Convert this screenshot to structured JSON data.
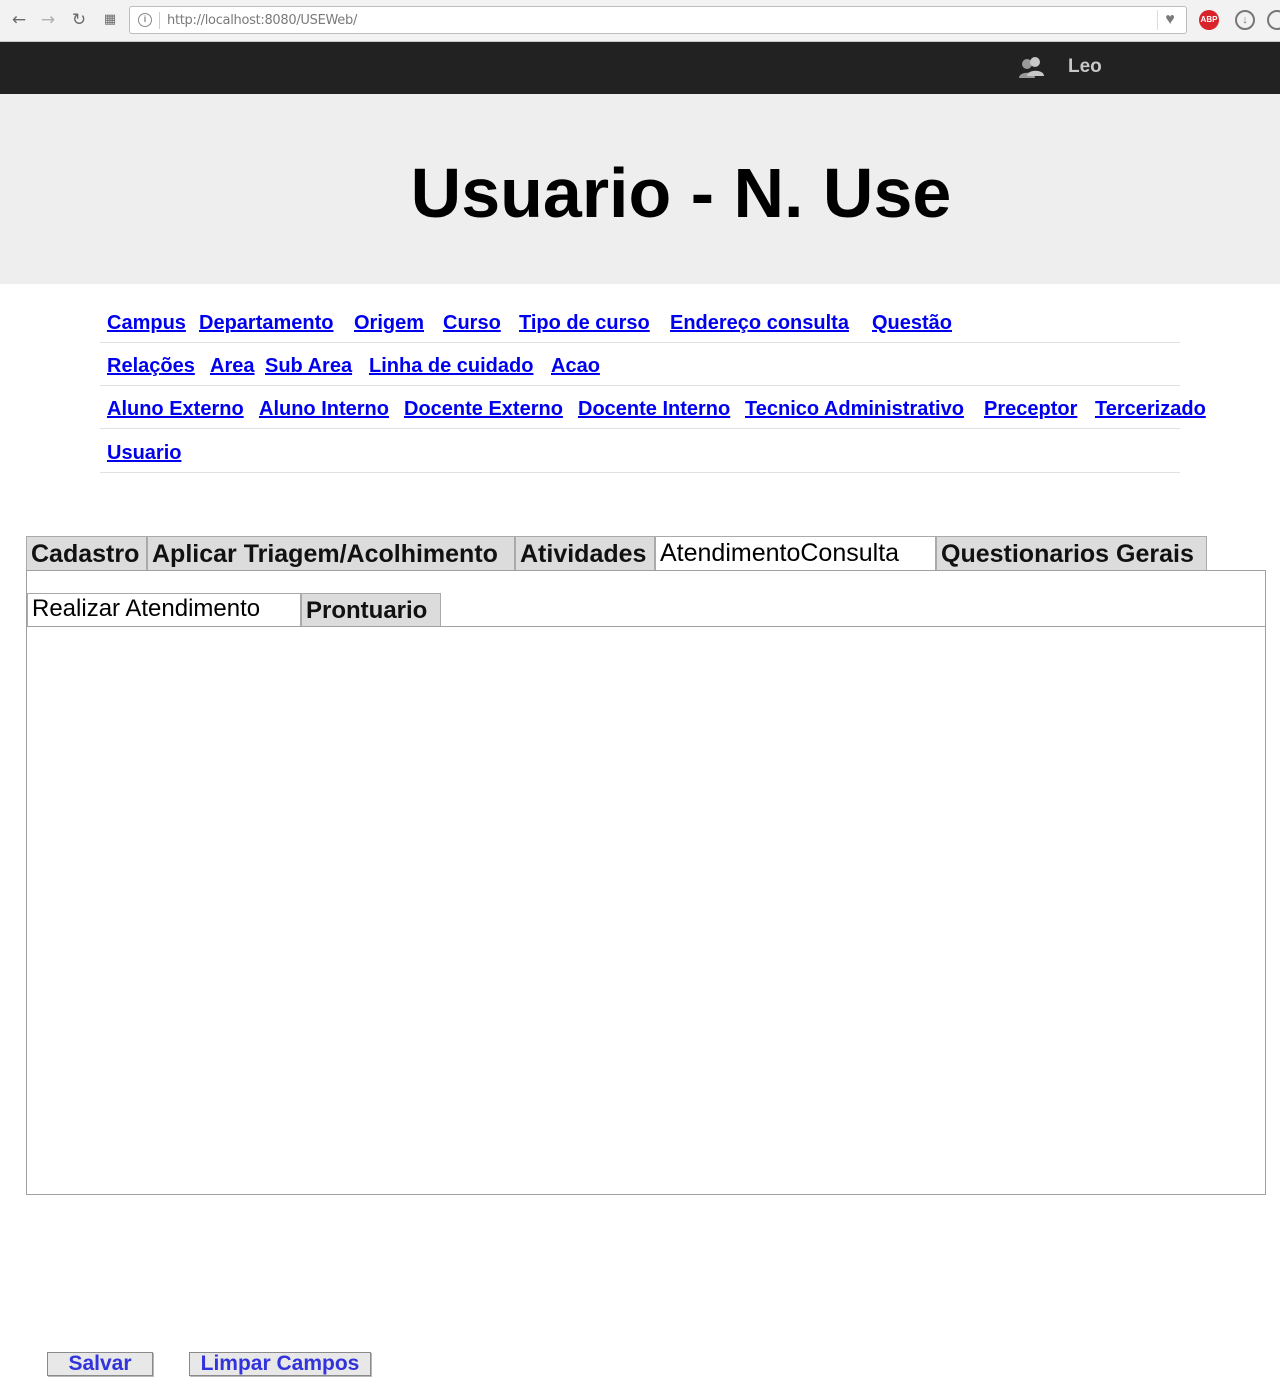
{
  "browser": {
    "url": "http://localhost:8080/USEWeb/",
    "abp_label": "ABP"
  },
  "topbar": {
    "user_name": "Leo",
    "user_icon": "users-icon"
  },
  "header": {
    "title": "Usuario - N. Use"
  },
  "menu": {
    "rows": [
      [
        "Campus",
        "Departamento",
        "Origem",
        "Curso",
        "Tipo de curso",
        "Endereço consulta",
        "Questão"
      ],
      [
        "Relações",
        "Area",
        "Sub Area",
        "Linha de cuidado",
        "Acao"
      ],
      [
        "Aluno Externo",
        "Aluno Interno",
        "Docente Externo",
        "Docente Interno",
        "Tecnico Administrativo",
        "Preceptor",
        "Tercerizado"
      ],
      [
        "Usuario"
      ]
    ]
  },
  "tabs": {
    "items": [
      "Cadastro",
      "Aplicar Triagem/Acolhimento",
      "Atividades",
      "AtendimentoConsulta",
      "Questionarios Gerais"
    ],
    "active": "AtendimentoConsulta"
  },
  "subtabs": {
    "items": [
      "Realizar Atendimento",
      "Prontuario"
    ],
    "active": "Realizar Atendimento"
  },
  "buttons": {
    "save": "Salvar",
    "clear": "Limpar Campos"
  },
  "colors": {
    "topbar": "#222222",
    "header": "#eeeeee",
    "link": "#0000ee",
    "button_text": "#3333dd"
  }
}
